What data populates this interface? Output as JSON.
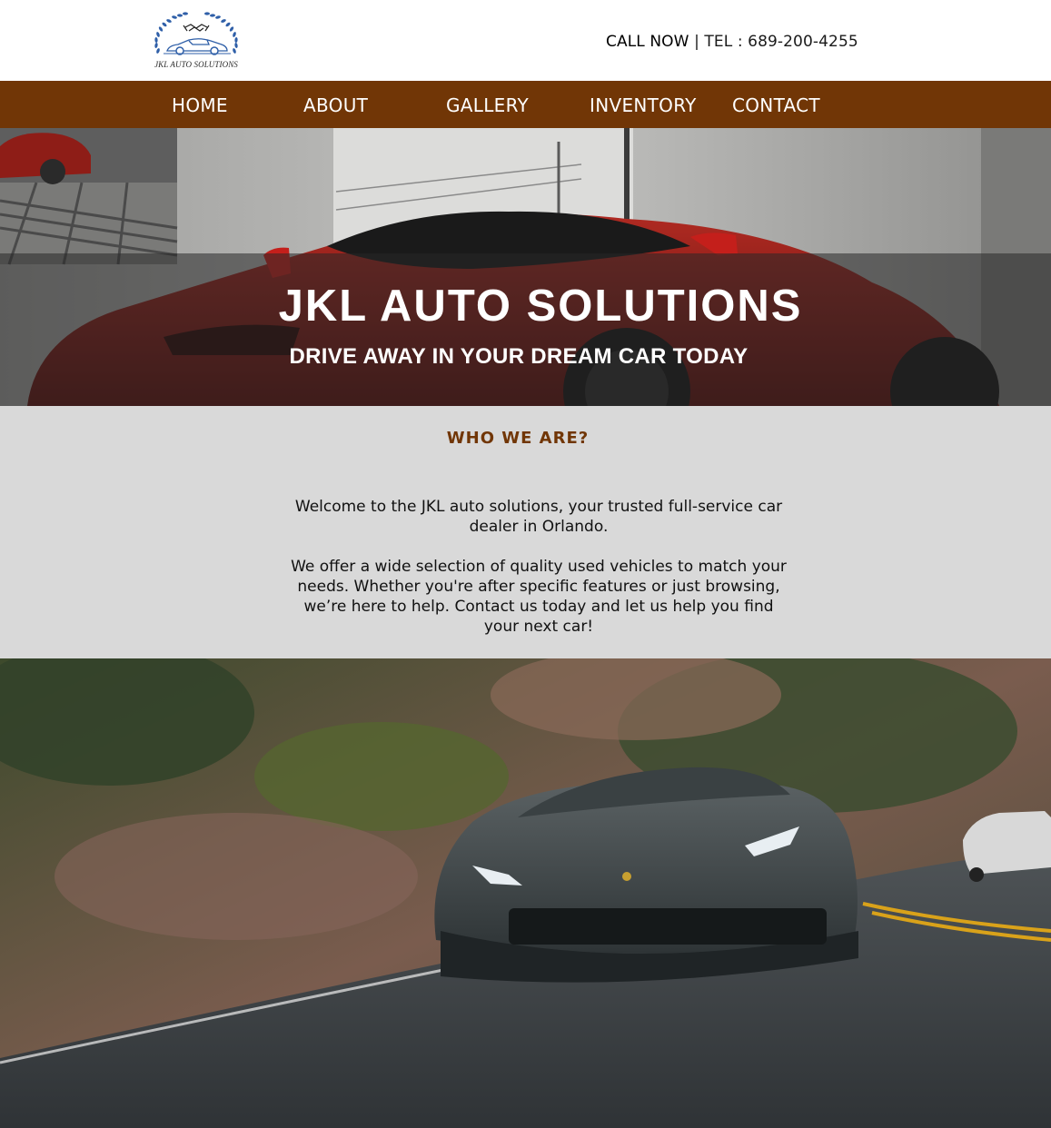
{
  "header": {
    "logo_text": "JKL AUTO SOLUTIONS",
    "call_label": "CALL NOW",
    "separator": "|",
    "tel_text": "TEL : 689-200-4255"
  },
  "nav": {
    "items": [
      {
        "label": "HOME"
      },
      {
        "label": "ABOUT"
      },
      {
        "label": "GALLERY"
      },
      {
        "label": "INVENTORY"
      },
      {
        "label": "CONTACT"
      }
    ]
  },
  "hero": {
    "title": "JKL AUTO SOLUTIONS",
    "subtitle": "DRIVE AWAY IN YOUR DREAM CAR TODAY"
  },
  "about": {
    "heading": "WHO WE ARE?",
    "paragraph1": "Welcome to the JKL auto solutions, your trusted full-service car dealer in Orlando.",
    "paragraph2": "We offer a wide selection of quality used vehicles to match your needs. Whether you're after specific features or just browsing, we’re here to help. Contact us today and let us help you find your next car!"
  },
  "colors": {
    "nav_bg": "#713606",
    "heading_brown": "#713606",
    "about_bg": "#d9d9d9",
    "logo_blue": "#2f5fa8"
  },
  "icons": {
    "logo": "car-handshake-laurel-logo"
  }
}
